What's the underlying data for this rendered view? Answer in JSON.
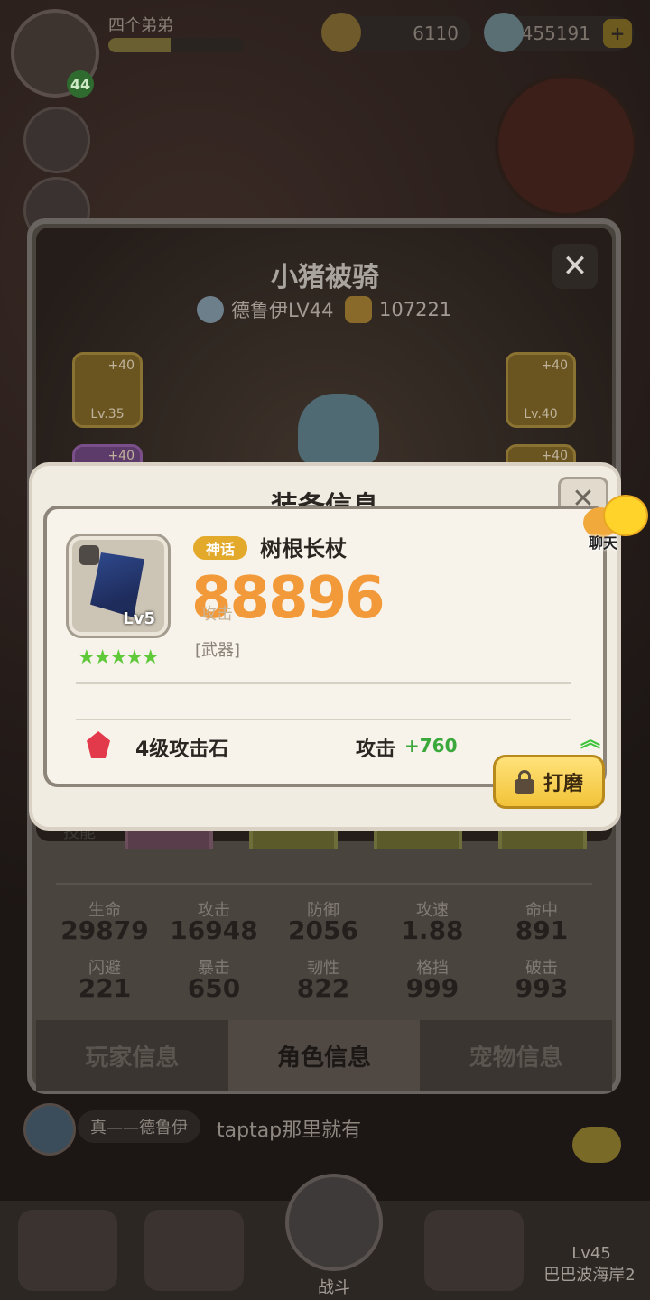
{
  "hud": {
    "player_name": "四个弟弟",
    "level": "44",
    "coins": "6110",
    "gems": "455191",
    "plus": "+"
  },
  "panel": {
    "title": "小猪被骑",
    "class_level": "德鲁伊LV44",
    "power": "107221",
    "close": "✕",
    "left_slots": [
      {
        "plus": "+40",
        "level": "Lv.35"
      },
      {
        "plus": "+40",
        "level": ""
      }
    ],
    "right_slots": [
      {
        "plus": "+40",
        "level": "Lv.40"
      },
      {
        "plus": "+40",
        "level": ""
      }
    ],
    "skills_label": "技能",
    "stats": [
      {
        "name": "生命",
        "value": "29879"
      },
      {
        "name": "攻击",
        "value": "16948"
      },
      {
        "name": "防御",
        "value": "2056"
      },
      {
        "name": "攻速",
        "value": "1.88"
      },
      {
        "name": "命中",
        "value": "891"
      },
      {
        "name": "闪避",
        "value": "221"
      },
      {
        "name": "暴击",
        "value": "650"
      },
      {
        "name": "韧性",
        "value": "822"
      },
      {
        "name": "格挡",
        "value": "999"
      },
      {
        "name": "破击",
        "value": "993"
      }
    ],
    "tabs": [
      "玩家信息",
      "角色信息",
      "宠物信息"
    ],
    "active_tab": 1
  },
  "chat": {
    "sender": "真——德鲁伊",
    "message": "taptap那里就有"
  },
  "bottom_nav": {
    "fight_label": "战斗",
    "map_level": "Lv45",
    "map_name": "巴巴波海岸2"
  },
  "equipment": {
    "title": "装备信息",
    "close": "✕",
    "rarity": "神话",
    "name": "树根长杖",
    "item_level": "Lv5",
    "stars": "★★★★★",
    "power": "88896",
    "power_label": "攻击",
    "type": "[武器]",
    "gem_name": "4级攻击石",
    "attr_label": "攻击",
    "attr_value": "+760",
    "polish_button": "打磨",
    "up_arrows": "︽"
  },
  "chat_button": {
    "label": "聊天"
  },
  "colors": {
    "power": "#f29a3a",
    "rarity_badge": "#e3a92a",
    "attr_positive": "#3aa83a",
    "polish_button": "#f2c338"
  }
}
